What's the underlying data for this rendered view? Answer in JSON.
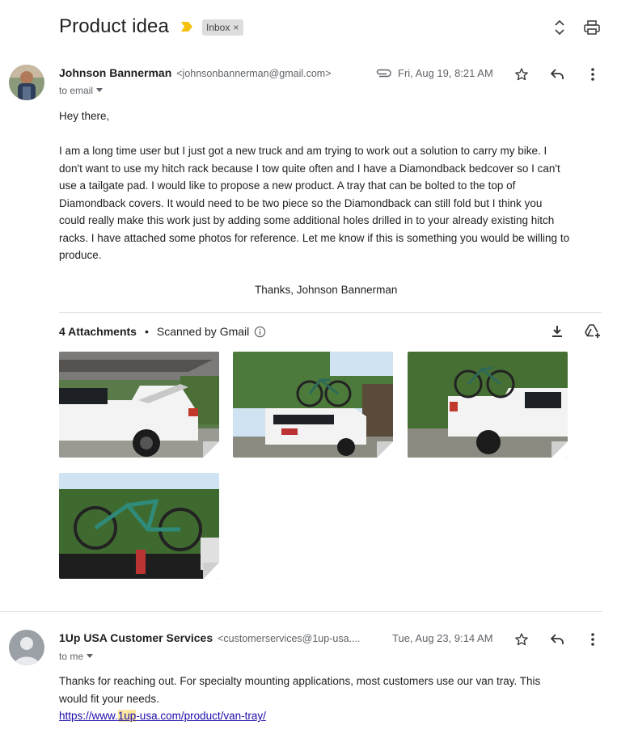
{
  "header": {
    "subject": "Product idea",
    "label": "Inbox",
    "label_close": "×"
  },
  "message1": {
    "sender_name": "Johnson Bannerman",
    "sender_email": "<johnsonbannerman@gmail.com>",
    "to": "to email",
    "date": "Fri, Aug 19, 8:21 AM",
    "greeting": "Hey there,",
    "para1_lines": [
      "I am a long time user but I just got a new truck and am trying to work out a solution to carry my bike. I",
      "don't want to use my hitch rack because I tow quite often and I have a Diamondback bedcover so I can't",
      "use a tailgate pad. I would like to propose a new product. A tray that can be bolted to the top of",
      "Diamondback covers. It would need to be two piece so the Diamondback can still fold but I think you",
      "could really make this work just by adding some additional holes drilled in to your already existing hitch",
      "racks. I have attached some photos for reference. Let me know if this is something you would be willing to",
      "produce."
    ],
    "signoff": "Thanks, Johnson Bannerman"
  },
  "attachments": {
    "count_label": "4 Attachments",
    "bullet": "•",
    "scanned_label": "Scanned by Gmail"
  },
  "message2": {
    "sender_name": "1Up USA Customer Services",
    "sender_email": "<customerservices@1up-usa....",
    "to": "to me",
    "date": "Tue, Aug 23, 9:14 AM",
    "body_line1": "Thanks for reaching out. For specialty mounting applications, most customers use our van tray. This",
    "body_line2": "would fit your needs.",
    "link_pre": "https://www.",
    "link_hl": "1up",
    "link_post": "-usa.com/product/van-tray/"
  },
  "colors": {
    "important_marker": "#f4c20d",
    "truck_white": "#f2f2f2",
    "sky": "#cfe3f2",
    "trees": "#3f6a2f"
  },
  "icons": [
    "important-marker-icon",
    "close-icon",
    "expand-collapse-icon",
    "print-icon",
    "paperclip-icon",
    "star-icon",
    "reply-icon",
    "more-vert-icon",
    "chevron-down-icon",
    "info-icon",
    "download-icon",
    "add-to-drive-icon"
  ]
}
